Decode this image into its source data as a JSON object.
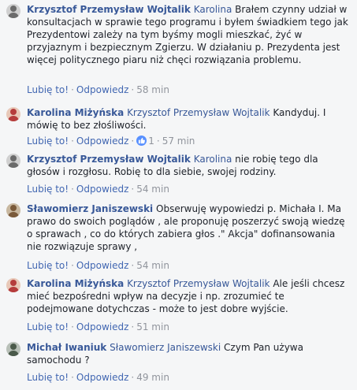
{
  "actions": {
    "like": "Lubię to!",
    "reply": "Odpowiedz",
    "sep": "·"
  },
  "comments": [
    {
      "author": "Krzysztof Przemysław Wojtalik",
      "mention": "Karolina",
      "text": "Brałem czynny udział w konsultacjach w sprawie tego programu i byłem świadkiem tego jak Prezydentowi zależy na tym byśmy mogli mieszkać, żyć w przyjaznym i bezpiecznym Zgierzu. W działaniu p. Prezydenta jest więcej politycznego piaru niż chęci rozwiązania problemu.",
      "time": "58 min",
      "avatar_color": "#6b6b6b"
    },
    {
      "author": "Karolina Miżyńska",
      "mention": "Krzysztof Przemysław Wojtalik",
      "text": "Kandyduj. I mówię to bez złośliwości.",
      "reaction_count": "1",
      "time": "57 min",
      "avatar_color": "#b53c3c"
    },
    {
      "author": "Krzysztof Przemysław Wojtalik",
      "mention": "Karolina",
      "text": "nie robię tego dla głosów i rozgłosu. Robię to dla siebie, swojej rodziny.",
      "time": "54 min",
      "avatar_color": "#6b6b6b"
    },
    {
      "author": "Sławomierz Janiszewski",
      "mention": "",
      "text": "Obserwuję wypowiedzi p. Michała I. Ma prawo do swoich poglądów , ale proponuję poszerzyć swoją wiedzę o sprawach , co do których zabiera głos .\" Akcja\" dofinansowania nie rozwiązuje sprawy ,",
      "time": "54 min",
      "avatar_color": "#7a5a3a"
    },
    {
      "author": "Karolina Miżyńska",
      "mention": "Krzysztof Przemysław Wojtalik",
      "text": "Ale jeśli chcesz mieć bezpośredni wpływ na decyzje i np. zrozumieć te podejmowane dotychczas - może to jest dobre wyjście.",
      "time": "51 min",
      "avatar_color": "#b53c3c"
    },
    {
      "author": "Michał Iwaniuk",
      "mention": "Sławomierz Janiszewski",
      "text": "Czym Pan używa samochodu ?",
      "time": "49 min",
      "avatar_color": "#4a5a4a"
    }
  ]
}
